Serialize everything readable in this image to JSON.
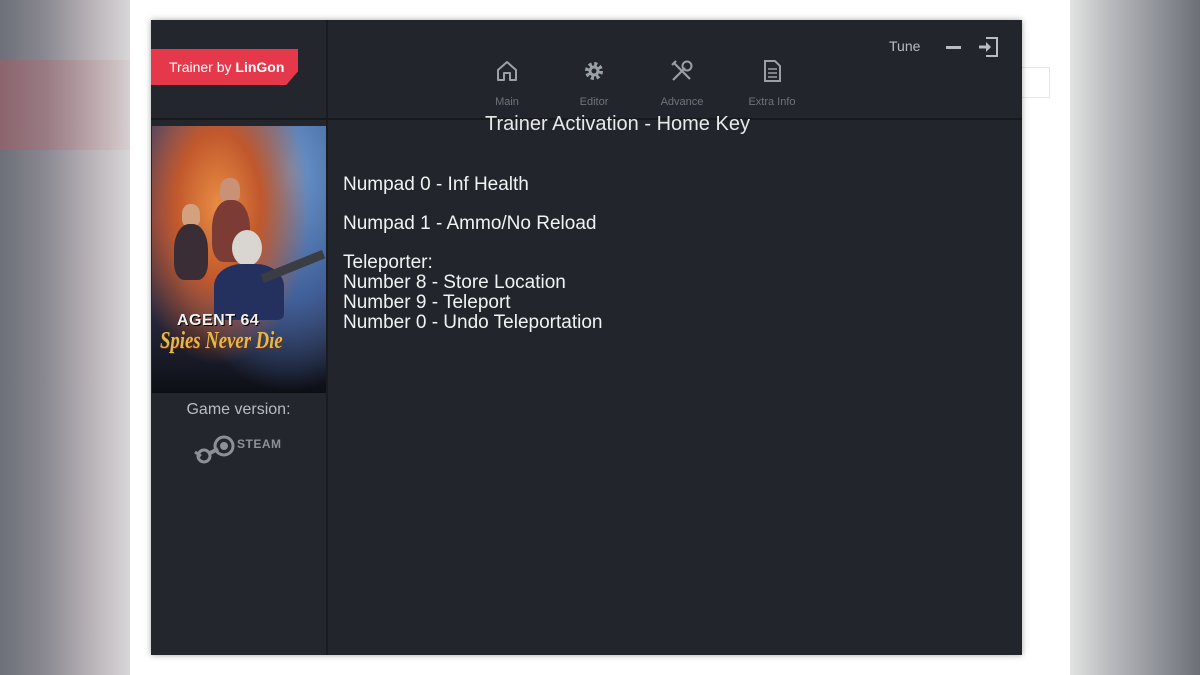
{
  "app": {
    "brand_prefix": "Trainer by ",
    "brand_name": "LinGon"
  },
  "colors": {
    "accent": "#e5394b",
    "window_bg": "#22252b",
    "text": "#f1f2f3",
    "muted": "#6f747c"
  },
  "sidebar": {
    "cover_title": "AGENT 64",
    "cover_subtitle": "Spies Never Die",
    "game_version_label": "Game version:",
    "platform": "STEAM",
    "platform_icon": "steam-logo-icon"
  },
  "nav": {
    "items": [
      {
        "label": "Main",
        "icon": "home-icon"
      },
      {
        "label": "Editor",
        "icon": "gear-icon"
      },
      {
        "label": "Advance",
        "icon": "tools-icon"
      },
      {
        "label": "Extra Info",
        "icon": "document-icon"
      }
    ]
  },
  "window_controls": {
    "tune_label": "Tune",
    "minimize_icon": "minimize-icon",
    "exit_icon": "exit-icon"
  },
  "content": {
    "title": "Trainer Activation - Home Key",
    "hotkeys": [
      "Numpad 0 - Inf Health",
      "Numpad 1 - Ammo/No Reload"
    ],
    "teleporter_heading": "Teleporter:",
    "teleporter_lines": [
      "Number 8 - Store Location",
      "Number 9 - Teleport",
      "Number 0 - Undo Teleportation"
    ]
  }
}
